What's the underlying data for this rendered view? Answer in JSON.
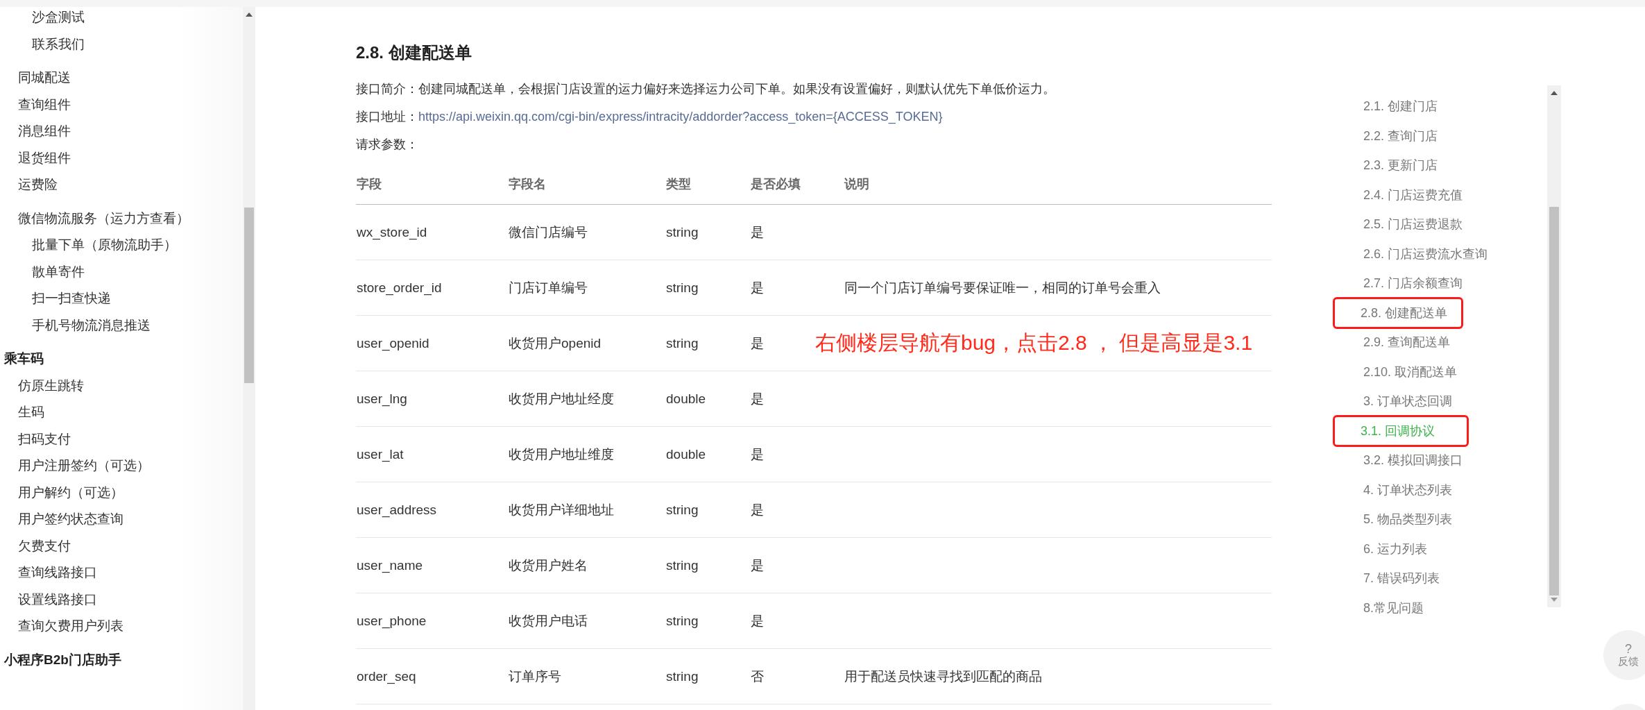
{
  "sidebar": {
    "items": [
      {
        "children": [
          {
            "children": [
              {
                "label": "沙盒测试"
              },
              {
                "label": "联系我们"
              }
            ]
          },
          {
            "label": "同城配送"
          },
          {
            "label": "查询组件"
          },
          {
            "label": "消息组件"
          },
          {
            "label": "退货组件"
          },
          {
            "label": "运费险"
          }
        ]
      },
      {
        "children": [
          {
            "label": "微信物流服务（运力方查看）",
            "children": [
              {
                "label": "批量下单（原物流助手）"
              },
              {
                "label": "散单寄件"
              },
              {
                "label": "扫一扫查快递"
              },
              {
                "label": "手机号物流消息推送"
              }
            ]
          }
        ]
      },
      {
        "label": "乘车码",
        "kind": "heading",
        "children": [
          {
            "label": "仿原生跳转"
          },
          {
            "label": "生码"
          },
          {
            "label": "扫码支付"
          },
          {
            "label": "用户注册签约（可选）"
          },
          {
            "label": "用户解约（可选）"
          },
          {
            "label": "用户签约状态查询"
          },
          {
            "label": "欠费支付"
          },
          {
            "label": "查询线路接口"
          },
          {
            "label": "设置线路接口"
          },
          {
            "label": "查询欠费用户列表"
          }
        ]
      },
      {
        "label": "小程序B2b门店助手",
        "kind": "heading"
      }
    ]
  },
  "article": {
    "title": "2.8. 创建配送单",
    "intro_label": "接口简介：",
    "intro": "创建同城配送单，会根据门店设置的运力偏好来选择运力公司下单。如果没有设置偏好，则默认优先下单低价运力。",
    "address_label": "接口地址：",
    "address": "https://api.weixin.qq.com/cgi-bin/express/intracity/addorder?access_token={ACCESS_TOKEN}",
    "params_label": "请求参数：",
    "table": {
      "columns": [
        "字段",
        "字段名",
        "类型",
        "是否必填",
        "说明"
      ],
      "rows": [
        [
          "wx_store_id",
          "微信门店编号",
          "string",
          "是",
          ""
        ],
        [
          "store_order_id",
          "门店订单编号",
          "string",
          "是",
          "同一个门店订单编号要保证唯一，相同的订单号会重入"
        ],
        [
          "user_openid",
          "收货用户openid",
          "string",
          "是",
          ""
        ],
        [
          "user_lng",
          "收货用户地址经度",
          "double",
          "是",
          ""
        ],
        [
          "user_lat",
          "收货用户地址维度",
          "double",
          "是",
          ""
        ],
        [
          "user_address",
          "收货用户详细地址",
          "string",
          "是",
          ""
        ],
        [
          "user_name",
          "收货用户姓名",
          "string",
          "是",
          ""
        ],
        [
          "user_phone",
          "收货用户电话",
          "string",
          "是",
          ""
        ],
        [
          "order_seq",
          "订单序号",
          "string",
          "否",
          "用于配送员快速寻找到匹配的商品"
        ]
      ]
    }
  },
  "annotation": "右侧楼层导航有bug，点击2.8 ， 但是高显是3.1",
  "floor_nav": {
    "items": [
      {
        "label": "2.1. 创建门店",
        "selected": false,
        "outlined": false
      },
      {
        "label": "2.2. 查询门店",
        "selected": false,
        "outlined": false
      },
      {
        "label": "2.3. 更新门店",
        "selected": false,
        "outlined": false
      },
      {
        "label": "2.4. 门店运费充值",
        "selected": false,
        "outlined": false
      },
      {
        "label": "2.5. 门店运费退款",
        "selected": false,
        "outlined": false
      },
      {
        "label": "2.6. 门店运费流水查询",
        "selected": false,
        "outlined": false
      },
      {
        "label": "2.7. 门店余额查询",
        "selected": false,
        "outlined": false
      },
      {
        "label": "2.8. 创建配送单",
        "selected": false,
        "outlined": true
      },
      {
        "label": "2.9. 查询配送单",
        "selected": false,
        "outlined": false
      },
      {
        "label": "2.10. 取消配送单",
        "selected": false,
        "outlined": false
      },
      {
        "label": "3. 订单状态回调",
        "selected": false,
        "outlined": false
      },
      {
        "label": "3.1. 回调协议",
        "selected": true,
        "outlined": true
      },
      {
        "label": "3.2. 模拟回调接口",
        "selected": false,
        "outlined": false
      },
      {
        "label": "4. 订单状态列表",
        "selected": false,
        "outlined": false
      },
      {
        "label": "5. 物品类型列表",
        "selected": false,
        "outlined": false
      },
      {
        "label": "6. 运力列表",
        "selected": false,
        "outlined": false
      },
      {
        "label": "7. 错误码列表",
        "selected": false,
        "outlined": false
      },
      {
        "label": "8.常见问题",
        "selected": false,
        "outlined": false
      }
    ]
  },
  "feedback": {
    "icon": "?",
    "label": "反馈"
  }
}
